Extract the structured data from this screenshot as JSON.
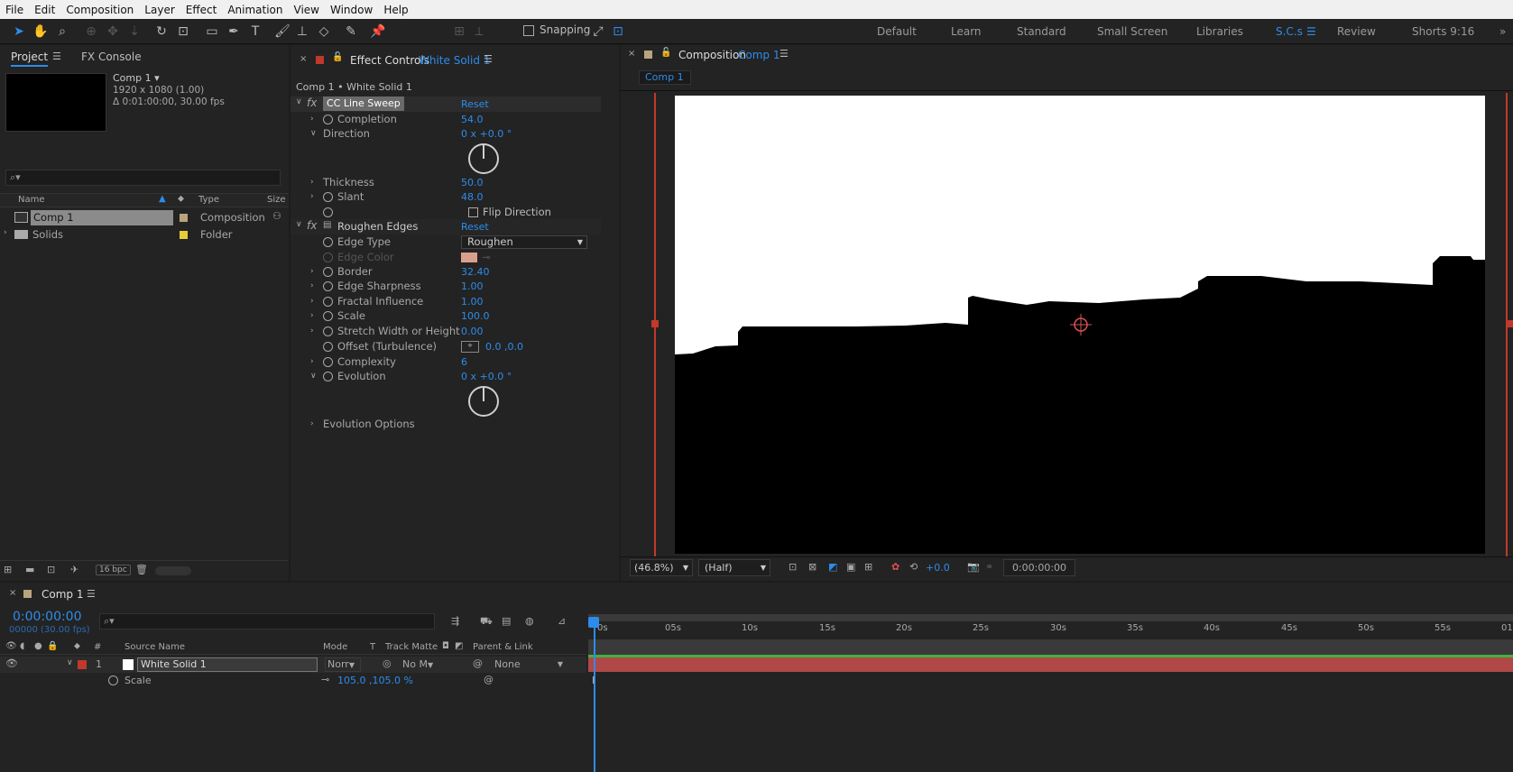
{
  "menu": [
    "File",
    "Edit",
    "Composition",
    "Layer",
    "Effect",
    "Animation",
    "View",
    "Window",
    "Help"
  ],
  "toolbar": {
    "snapping": "Snapping",
    "workspaces": [
      "Default",
      "Learn",
      "Standard",
      "Small Screen",
      "Libraries",
      "S.C.s",
      "Review",
      "Shorts 9:16"
    ]
  },
  "project": {
    "tab": "Project",
    "tab2": "FX Console",
    "comp_name": "Comp 1 ▾",
    "comp_size": "1920 x 1080 (1.00)",
    "comp_dur": "Δ 0:01:00:00, 30.00 fps",
    "search_placeholder": "⌕▾",
    "col_name": "Name",
    "col_type": "Type",
    "col_size": "Size",
    "items": [
      {
        "name": "Comp 1",
        "type": "Composition"
      },
      {
        "name": "Solids",
        "type": "Folder"
      }
    ],
    "bpc": "16 bpc"
  },
  "effect": {
    "tab": "Effect Controls",
    "layer": "White Solid 1",
    "path": "Comp 1 • White Solid 1",
    "fx1": {
      "name": "CC Line Sweep",
      "reset": "Reset",
      "completion_label": "Completion",
      "completion": "54.0",
      "direction_label": "Direction",
      "direction": "0 x +0.0 °",
      "thickness_label": "Thickness",
      "thickness": "50.0",
      "slant_label": "Slant",
      "slant": "48.0",
      "flip_label": "Flip Direction"
    },
    "fx2": {
      "name": "Roughen Edges",
      "reset": "Reset",
      "edge_type_label": "Edge Type",
      "edge_type": "Roughen",
      "edge_color_label": "Edge Color",
      "border_label": "Border",
      "border": "32.40",
      "sharp_label": "Edge Sharpness",
      "sharp": "1.00",
      "fractal_label": "Fractal Influence",
      "fractal": "1.00",
      "scale_label": "Scale",
      "scale": "100.0",
      "stretch_label": "Stretch Width or Height",
      "stretch": "0.00",
      "offset_label": "Offset (Turbulence)",
      "offset": "0.0 ,0.0",
      "complexity_label": "Complexity",
      "complexity": "6",
      "evolution_label": "Evolution",
      "evolution": "0 x +0.0 °",
      "evo_opts_label": "Evolution Options"
    }
  },
  "comp": {
    "tab": "Composition",
    "name": "Comp 1",
    "subtab": "Comp 1",
    "zoom": "(46.8%)",
    "res": "(Half)",
    "exposure": "+0.0",
    "timecode": "0:00:00:00"
  },
  "timeline": {
    "tab": "Comp 1",
    "timecode": "0:00:00:00",
    "frames": "00000 (30.00 fps)",
    "headers": {
      "source": "Source Name",
      "mode": "Mode",
      "t": "T",
      "matte": "Track Matte",
      "parent": "Parent & Link",
      "num": "#"
    },
    "layer": {
      "num": "1",
      "name": "White Solid 1",
      "mode": "Norr",
      "matte": "No M",
      "parent": "None"
    },
    "scale_label": "Scale",
    "scale_val": "105.0 ,105.0 %",
    "ruler": [
      "0s",
      "05s",
      "10s",
      "15s",
      "20s",
      "25s",
      "30s",
      "35s",
      "40s",
      "45s",
      "50s",
      "55s",
      "01"
    ]
  },
  "colors": {
    "accent": "#2d8ceb",
    "layer_bar": "#b04848",
    "label_red": "#c0392b",
    "comp_swatch": "#b9a47e",
    "folder_swatch": "#e7cd3a",
    "edge_color": "#d8a08c"
  }
}
